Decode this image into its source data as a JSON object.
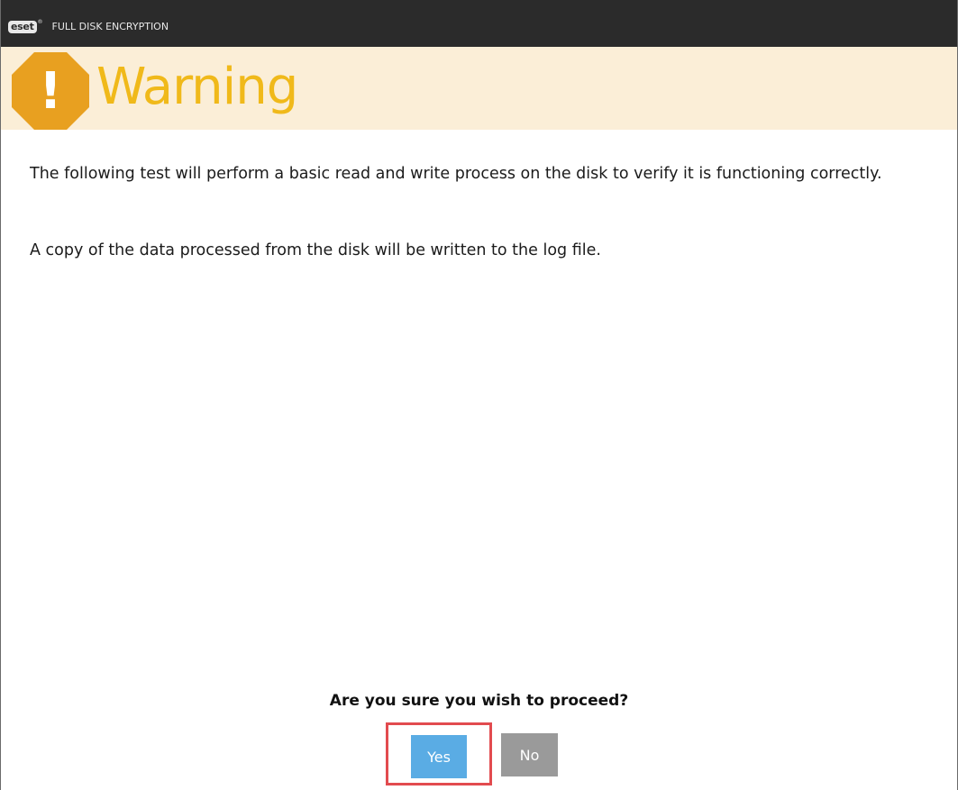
{
  "titlebar": {
    "logo_text": "eset",
    "logo_registered": "®",
    "product_name": "FULL DISK ENCRYPTION"
  },
  "banner": {
    "icon": "warning-octagon-icon",
    "icon_glyph": "!",
    "title": "Warning",
    "colors": {
      "background": "#fbeed7",
      "title": "#f0b91a",
      "icon": "#e8a020"
    }
  },
  "content": {
    "paragraph_1": "The following test will perform a basic read and write process on the disk to verify it is functioning correctly.",
    "paragraph_2": "A copy of the data processed from the disk will be written to the log file."
  },
  "prompt": {
    "question": "Are you sure you wish to proceed?",
    "yes_label": "Yes",
    "no_label": "No",
    "colors": {
      "yes": "#5aace4",
      "no": "#9a9a9a",
      "highlight": "#e24b4f"
    }
  }
}
